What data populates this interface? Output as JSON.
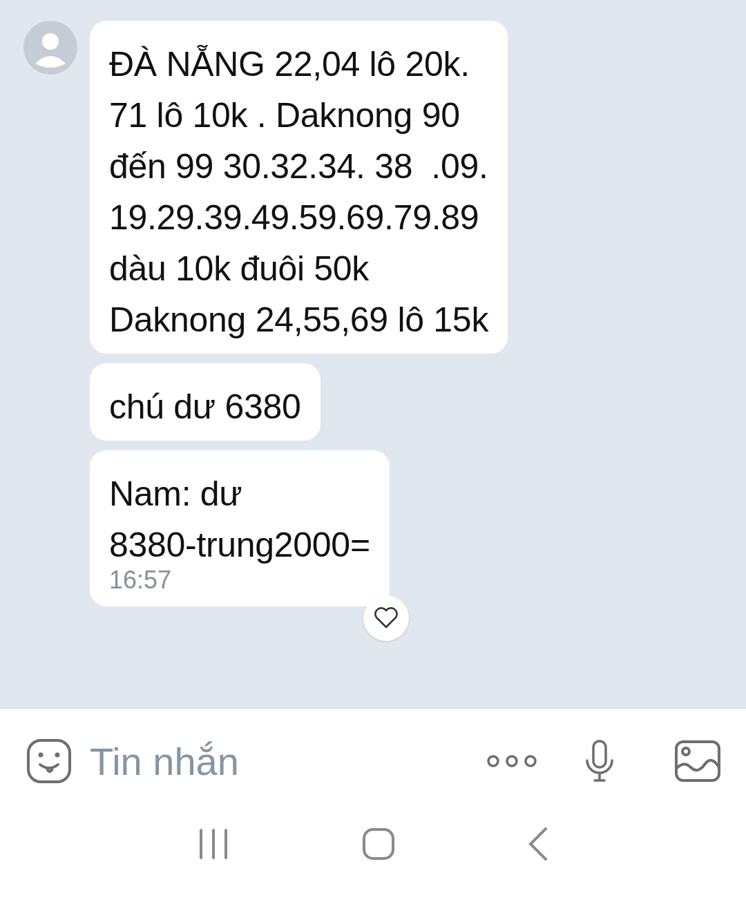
{
  "messages": [
    {
      "text": "ĐÀ NẴNG 22,04 lô 20k.\n71 lô 10k . Daknong 90\nđến 99 30.32.34. 38  .09.\n19.29.39.49.59.69.79.89\ndàu 10k đuôi 50k\nDaknong 24,55,69 lô 15k"
    },
    {
      "text": "chú dư 6380"
    },
    {
      "text": "Nam: dư\n8380-trung2000=",
      "time": "16:57",
      "reacted": false
    }
  ],
  "composer": {
    "placeholder": "Tin nhắn"
  }
}
